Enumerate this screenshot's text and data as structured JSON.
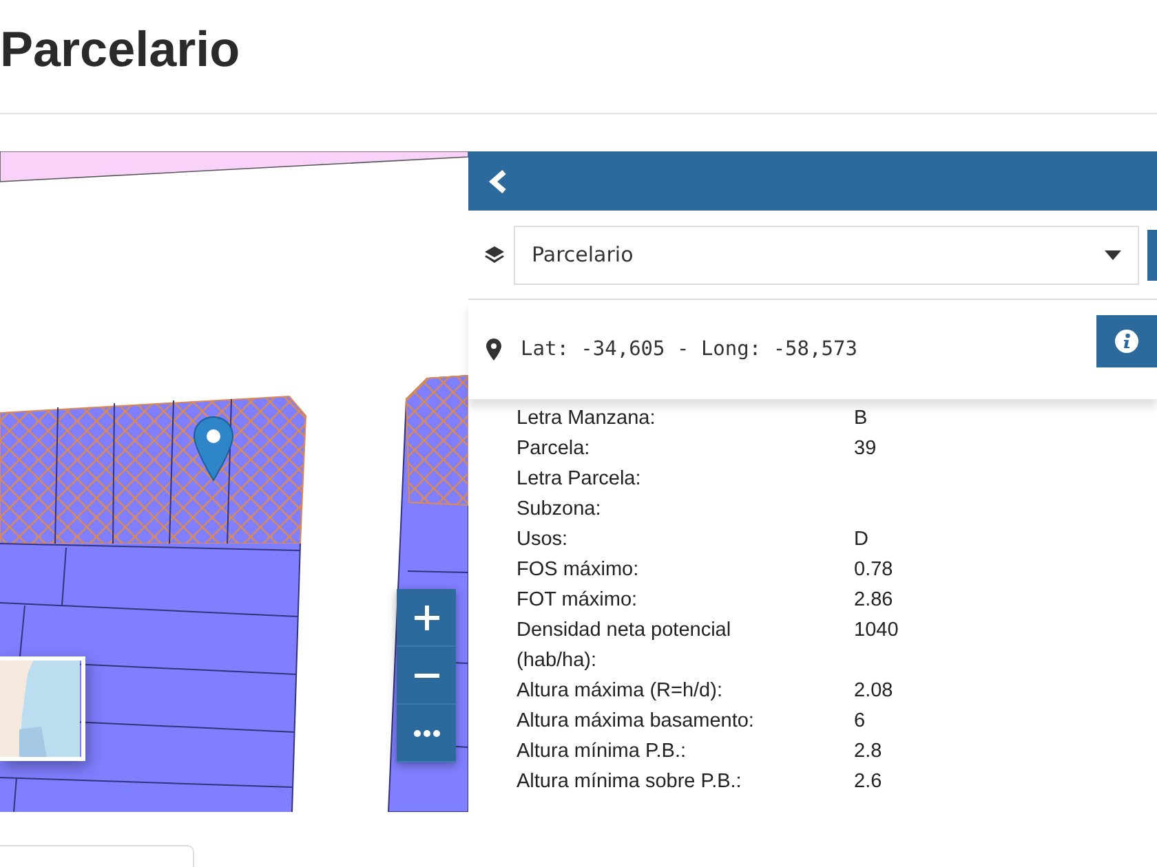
{
  "page": {
    "title": "Parcelario"
  },
  "panel": {
    "layer_select": {
      "value": "Parcelario"
    },
    "coordinates": "Lat: -34,605 - Long: -58,573",
    "attributes": [
      {
        "label": "Letra Manzana:",
        "value": "B"
      },
      {
        "label": "Parcela:",
        "value": "39"
      },
      {
        "label": "Letra Parcela:"
      },
      {
        "label": "Subzona:"
      },
      {
        "label": "Usos:",
        "value": "D"
      },
      {
        "label": "FOS máximo:",
        "value": "0.78"
      },
      {
        "label": "FOT máximo:",
        "value": "2.86"
      },
      {
        "label": "Densidad neta potencial (hab/ha):",
        "value": "1040"
      },
      {
        "label": "Altura máxima (R=h/d):",
        "value": "2.08"
      },
      {
        "label": "Altura máxima basamento:",
        "value": "6"
      },
      {
        "label": "Altura mínima P.B.:",
        "value": "2.8"
      },
      {
        "label": "Altura mínima sobre P.B.:",
        "value": "2.6"
      }
    ]
  }
}
